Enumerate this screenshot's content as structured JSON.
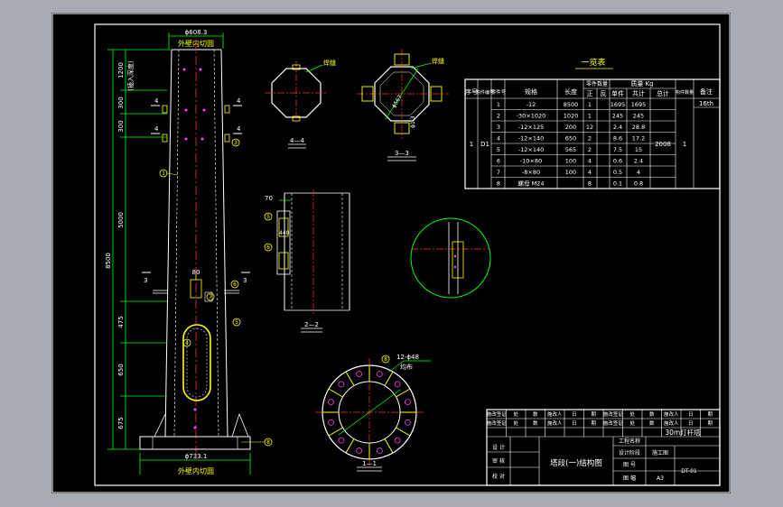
{
  "colors": {
    "background": "#000000",
    "frame": "#ffffff",
    "centerline": "#ff3030",
    "dimension": "#00ff00",
    "label": "#ffff00",
    "callout": "#00ff00",
    "bolt": "#ff40ff"
  },
  "elevation": {
    "top_dim": "ϕ608.3",
    "top_caption": "外壁内切圆",
    "bottom_dim": "ϕ733.1",
    "bottom_caption": "外壁内切圆",
    "total_height": "8500",
    "segments": [
      "1200",
      "300",
      "300",
      "5000",
      "475",
      "650",
      "675"
    ],
    "top_note": "(插入深度)",
    "section_marks": [
      "4",
      "4",
      "4",
      "4",
      "3",
      "3"
    ],
    "door_dim": "80",
    "callouts": [
      "1",
      "2",
      "3",
      "4",
      "5",
      "6",
      "7",
      "8"
    ]
  },
  "section_4_4": {
    "label": "4—4",
    "note": "焊缝"
  },
  "section_3_3": {
    "label": "3—3",
    "note": "焊缝",
    "dim_a": "ϕ567",
    "dim_b": "ϕ1.3"
  },
  "section_2_2": {
    "label": "2—2",
    "dim_width": "70",
    "dim_height": "440",
    "callouts": [
      "5",
      "6"
    ]
  },
  "flange_view": {
    "label": "1—1",
    "note_line1": "12-ϕ48",
    "note_line2": "均布",
    "callout": "8"
  },
  "parts_table": {
    "title": "一览表",
    "headers": {
      "seq": "序号",
      "member_no": "构件编号",
      "part_no": "零件号",
      "spec": "规格",
      "length": "长度",
      "qty": "零件数量",
      "qty_pos": "正",
      "qty_neg": "反",
      "mass": "质量 Kg",
      "unit": "单件",
      "subtotal": "共计",
      "total": "总计",
      "member_qty": "构件数量",
      "remark": "备注"
    },
    "seq": "1",
    "member_no": "D1",
    "total": "2008",
    "member_qty": "1",
    "remark": "16th",
    "rows": [
      {
        "no": "1",
        "spec": "-12",
        "length": "8500",
        "qty": "1",
        "unit": "1695",
        "subtotal": "1695"
      },
      {
        "no": "2",
        "spec": "-30×1020",
        "length": "1020",
        "qty": "1",
        "unit": "245",
        "subtotal": "245"
      },
      {
        "no": "3",
        "spec": "-12×125",
        "length": "200",
        "qty": "12",
        "unit": "2.4",
        "subtotal": "28.8"
      },
      {
        "no": "4",
        "spec": "-12×140",
        "length": "650",
        "qty": "2",
        "unit": "8.6",
        "subtotal": "17.2"
      },
      {
        "no": "5",
        "spec": "-12×140",
        "length": "565",
        "qty": "2",
        "unit": "7.5",
        "subtotal": "15"
      },
      {
        "no": "6",
        "spec": "-10×80",
        "length": "100",
        "qty": "4",
        "unit": "0.6",
        "subtotal": "2.4"
      },
      {
        "no": "7",
        "spec": "-8×80",
        "length": "100",
        "qty": "4",
        "unit": "0.5",
        "subtotal": "4"
      },
      {
        "no": "8",
        "spec": "螺母 M24",
        "length": "",
        "qty": "8",
        "unit": "0.1",
        "subtotal": "0.8"
      }
    ]
  },
  "title_block": {
    "rev_headers": [
      "施改签证",
      "处",
      "数",
      "施改人",
      "日",
      "期"
    ],
    "project_label": "工程名称",
    "project_name": "30m灯杆塔",
    "drawing_title": "塔段(一)结构图",
    "left_roles": [
      "设 计",
      "审 核",
      "校 对"
    ],
    "right_roles": [
      "设计阶段",
      "施工图",
      "图 号",
      "DT-01",
      "图 幅",
      "A3"
    ]
  }
}
